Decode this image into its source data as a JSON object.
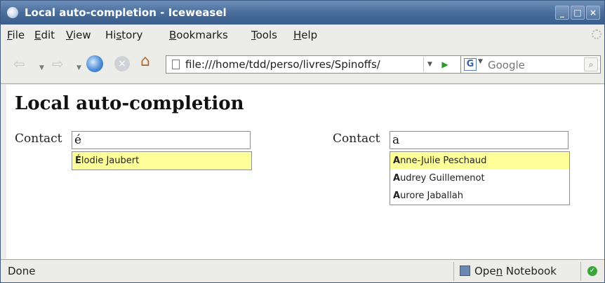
{
  "window": {
    "title": "Local auto-completion - Iceweasel",
    "controls": {
      "minimize": "_",
      "maximize": "□",
      "close": "×"
    }
  },
  "menu": {
    "items": [
      {
        "label": "File",
        "accel": "F",
        "rest": "ile"
      },
      {
        "label": "Edit",
        "accel": "E",
        "rest": "dit"
      },
      {
        "label": "View",
        "accel": "V",
        "rest": "iew"
      },
      {
        "label": "History",
        "pre": "Hi",
        "accel": "s",
        "rest": "tory"
      },
      {
        "label": "Bookmarks",
        "accel": "B",
        "rest": "ookmarks"
      },
      {
        "label": "Tools",
        "accel": "T",
        "rest": "ools"
      },
      {
        "label": "Help",
        "accel": "H",
        "rest": "elp"
      }
    ]
  },
  "toolbar": {
    "url": "file:///home/tdd/perso/livres/Spinoffs/",
    "search_placeholder": "Google",
    "search_engine": "G",
    "icons": [
      "back-icon",
      "forward-icon",
      "reload-icon",
      "stop-icon",
      "home-icon"
    ]
  },
  "page": {
    "heading": "Local auto-completion",
    "fields": [
      {
        "label": "Contact",
        "value": "é",
        "suggestions": [
          {
            "match": "É",
            "rest": "lodie Jaubert",
            "selected": true
          }
        ]
      },
      {
        "label": "Contact",
        "value": "a",
        "suggestions": [
          {
            "match": "A",
            "rest": "nne-Julie Peschaud",
            "selected": true
          },
          {
            "match": "A",
            "rest": "udrey Guillemenot",
            "selected": false
          },
          {
            "match": "A",
            "rest": "urore Jaballah",
            "selected": false
          }
        ]
      }
    ]
  },
  "status": {
    "text": "Done",
    "notebook_pre": "Ope",
    "notebook_accel": "n",
    "notebook_rest": " Notebook"
  },
  "colors": {
    "titlebar": "#4a6e9c",
    "highlight": "#ffff99",
    "chrome": "#ecece9"
  }
}
